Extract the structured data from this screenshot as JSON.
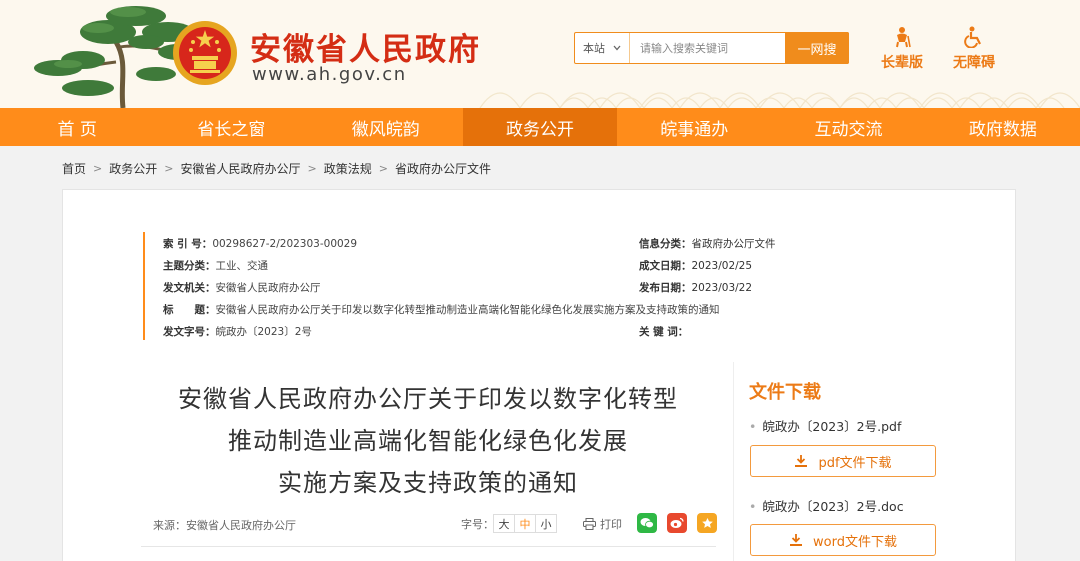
{
  "header": {
    "site_title": "安徽省人民政府",
    "site_url": "www.ah.gov.cn",
    "search": {
      "scope": "本站",
      "placeholder": "请输入搜索关键词",
      "button": "一网搜"
    },
    "modes": [
      {
        "label": "长辈版",
        "icon": "elder-mode-icon"
      },
      {
        "label": "无障碍",
        "icon": "accessibility-icon"
      }
    ]
  },
  "nav": {
    "items": [
      {
        "label": "首 页",
        "active": false
      },
      {
        "label": "省长之窗",
        "active": false
      },
      {
        "label": "徽风皖韵",
        "active": false
      },
      {
        "label": "政务公开",
        "active": true
      },
      {
        "label": "皖事通办",
        "active": false
      },
      {
        "label": "互动交流",
        "active": false
      },
      {
        "label": "政府数据",
        "active": false
      }
    ]
  },
  "breadcrumb": [
    "首页",
    "政务公开",
    "安徽省人民政府办公厅",
    "政策法规",
    "省政府办公厅文件"
  ],
  "meta": {
    "index_label": "索 引 号：",
    "index_value": "00298627-2/202303-00029",
    "category_label": "信息分类：",
    "category_value": "省政府办公厅文件",
    "theme_label": "主题分类：",
    "theme_value": "工业、交通",
    "created_label": "成文日期：",
    "created_value": "2023/02/25",
    "issuer_label": "发文机关：",
    "issuer_value": "安徽省人民政府办公厅",
    "published_label": "发布日期：",
    "published_value": "2023/03/22",
    "title_label": "标　　题：",
    "title_value": "安徽省人民政府办公厅关于印发以数字化转型推动制造业高端化智能化绿色化发展实施方案及支持政策的通知",
    "docno_label": "发文字号：",
    "docno_value": "皖政办〔2023〕2号",
    "keywords_label": "关 键 词："
  },
  "article": {
    "title_lines": [
      "安徽省人民政府办公厅关于印发以数字化转型",
      "推动制造业高端化智能化绿色化发展",
      "实施方案及支持政策的通知"
    ],
    "source": "来源：安徽省人民政府办公厅",
    "font_label": "字号：",
    "font_sizes": [
      "大",
      "中",
      "小"
    ],
    "font_active": "中",
    "print": "打印"
  },
  "downloads": {
    "title": "文件下载",
    "files": [
      {
        "name": "皖政办〔2023〕2号.pdf",
        "button": "pdf文件下载"
      },
      {
        "name": "皖政办〔2023〕2号.doc",
        "button": "word文件下载"
      }
    ]
  },
  "colors": {
    "accent": "#ff8c1a",
    "nav_active": "#e5710a",
    "title_red": "#d42d14"
  }
}
